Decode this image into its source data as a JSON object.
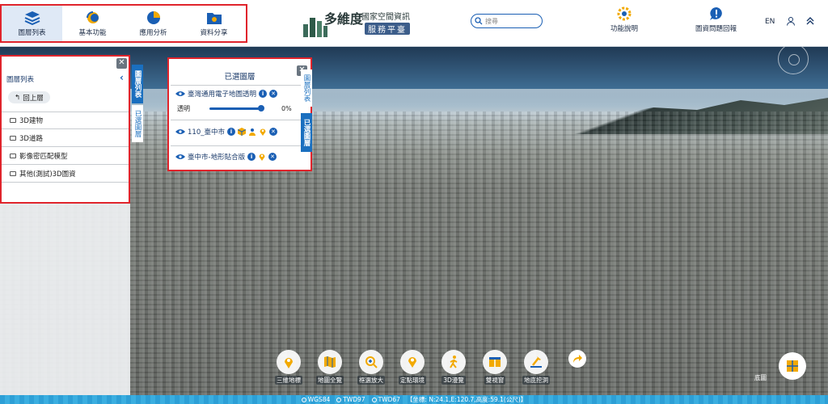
{
  "nav": {
    "items": [
      {
        "label": "圖層列表",
        "icon": "layers-icon",
        "active": true
      },
      {
        "label": "基本功能",
        "icon": "basic-function-icon",
        "active": false
      },
      {
        "label": "應用分析",
        "icon": "pie-chart-icon",
        "active": false
      },
      {
        "label": "資料分享",
        "icon": "folder-share-icon",
        "active": false
      }
    ],
    "logo_main": "多維度",
    "logo_sub1": "國家空間資訊",
    "logo_sub2": "服務平臺",
    "search_placeholder": "搜尋",
    "help_label": "功能說明",
    "feedback_label": "圖資問題回報",
    "lang": "EN"
  },
  "layer_panel": {
    "header": "圖層列表",
    "back_label": "回上層",
    "rows": [
      "3D建物",
      "3D道路",
      "影像密匹配模型",
      "其他(測試)3D圖資"
    ],
    "tab_on": "圖層列表",
    "tab_off": "已選圖層"
  },
  "selected_panel": {
    "title": "已選圖層",
    "layers": [
      {
        "name": "臺灣通用電子地圖透明",
        "opacity_label": "透明",
        "opacity_value": "0%"
      },
      {
        "name": "110_臺中市"
      },
      {
        "name": "臺中市-地形貼合版"
      }
    ],
    "tab_on": "已選圖層",
    "tab_off": "圖層列表"
  },
  "toolbar": {
    "tools": [
      {
        "label": "三維地標",
        "icon": "landmark-pin-icon"
      },
      {
        "label": "地圖全覽",
        "icon": "map-overview-icon"
      },
      {
        "label": "框選放大",
        "icon": "zoom-box-icon"
      },
      {
        "label": "定點環境",
        "icon": "location-pin-icon"
      },
      {
        "label": "3D漫覽",
        "icon": "walk-icon"
      },
      {
        "label": "雙視窗",
        "icon": "dual-window-icon"
      },
      {
        "label": "地底挖洞",
        "icon": "dig-icon"
      }
    ],
    "more_icon": "share-arrow-icon"
  },
  "basemap_label": "底圖",
  "status": {
    "options": [
      "WGS84",
      "TWD97",
      "TWD67"
    ],
    "selected": "WGS84",
    "coords": "【坐標: N:24.1,E:120.7,高度:59.1(公尺)】"
  },
  "colors": {
    "accent": "#1a5fb4",
    "highlight": "#e0242c",
    "status_bar": "#2d9fd6"
  }
}
